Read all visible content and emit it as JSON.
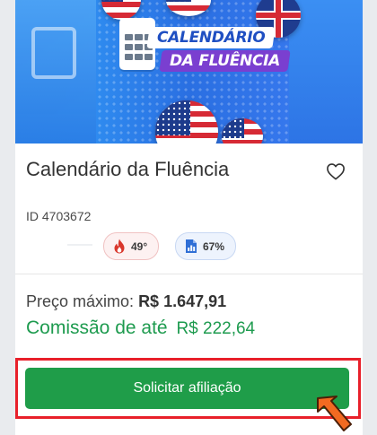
{
  "banner": {
    "line1": "CALENDÁRIO",
    "line2": "DA FLUÊNCIA"
  },
  "product": {
    "title": "Calendário da Fluência",
    "id_text": "ID 4703672",
    "temperature": "49°",
    "approval": "67%"
  },
  "pricing": {
    "max_price_label": "Preço máximo:",
    "max_price_value": "R$ 1.647,91",
    "commission_label": "Comissão de até",
    "commission_value": "R$ 222,64"
  },
  "cta": {
    "label": "Solicitar afiliação"
  },
  "colors": {
    "cta_green": "#1f9d49",
    "commission_green": "#1e9b4f",
    "highlight_red": "#e8202a",
    "arrow_orange": "#f26a21"
  },
  "icons": {
    "favorite": "heart-outline-icon",
    "temperature": "flame-icon",
    "approval": "bar-chart-document-icon",
    "pointer": "arrow-pointer-icon"
  }
}
